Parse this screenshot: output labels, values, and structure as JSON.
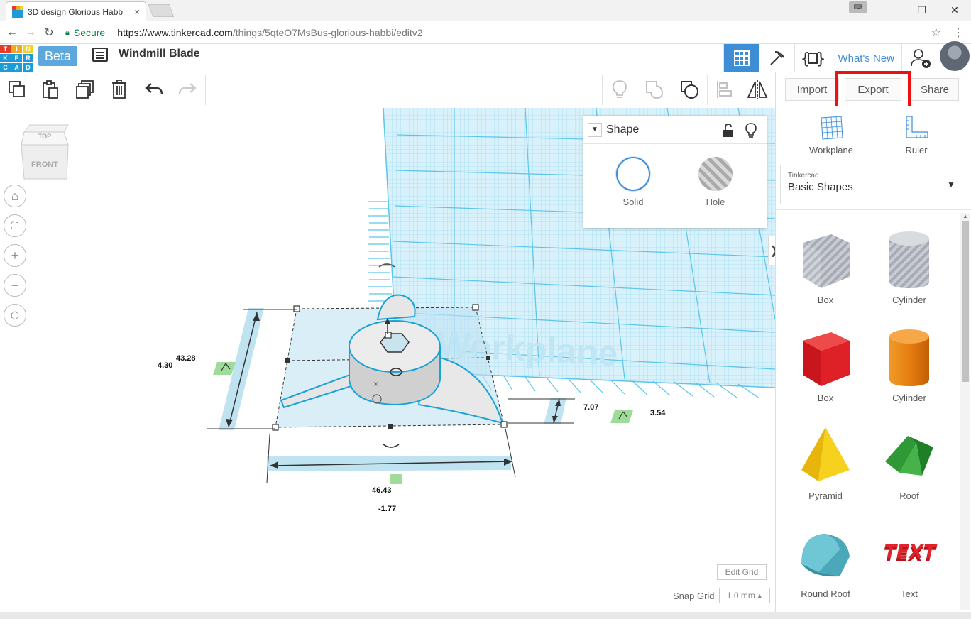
{
  "browser": {
    "tab_title": "3D design Glorious Habb",
    "tab_close": "×",
    "secure_label": "Secure",
    "url_host": "https://www.tinkercad.com",
    "url_path": "/things/5qteO7MsBus-glorious-habbi/editv2",
    "window_controls": [
      "—",
      "❐",
      "✕"
    ]
  },
  "app": {
    "logo_letters": [
      "T",
      "I",
      "N",
      "K",
      "E",
      "R",
      "C",
      "A",
      "D"
    ],
    "logo_colors": [
      "#e53a27",
      "#f0a91e",
      "#f7d024",
      "#1b9bd7",
      "#1b9bd7",
      "#1b9bd7",
      "#1b9bd7",
      "#1b9bd7",
      "#1b9bd7"
    ],
    "beta_label": "Beta",
    "design_title": "Windmill Blade",
    "whats_new": "What's New"
  },
  "toolbar": {
    "import_label": "Import",
    "export_label": "Export",
    "share_label": "Share"
  },
  "shape_panel": {
    "title": "Shape",
    "solid_label": "Solid",
    "hole_label": "Hole"
  },
  "dimensions": {
    "height": "43.28",
    "height_partial": "4.30",
    "width": "46.43",
    "depth": "7.07",
    "elevation": "3.54",
    "offset": "-1.77"
  },
  "viewcube": {
    "top_label": "TOP",
    "front_label": "FRONT"
  },
  "workplane_watermark": "Workplane",
  "grid": {
    "edit_label": "Edit Grid",
    "snap_label": "Snap Grid",
    "snap_value": "1.0 mm ▴"
  },
  "right_panel": {
    "workplane_label": "Workplane",
    "ruler_label": "Ruler",
    "library_provider": "Tinkercad",
    "library_name": "Basic Shapes",
    "shapes": [
      {
        "label": "Box",
        "icon": "box-hole-icon"
      },
      {
        "label": "Cylinder",
        "icon": "cylinder-hole-icon"
      },
      {
        "label": "Box",
        "icon": "box-solid-icon"
      },
      {
        "label": "Cylinder",
        "icon": "cylinder-solid-icon"
      },
      {
        "label": "Pyramid",
        "icon": "pyramid-icon"
      },
      {
        "label": "Roof",
        "icon": "roof-icon"
      },
      {
        "label": "Round Roof",
        "icon": "round-roof-icon"
      },
      {
        "label": "Text",
        "icon": "text-shape-icon"
      }
    ]
  },
  "colors": {
    "accent_blue": "#3e8dd7",
    "highlight_red": "#ee1111",
    "grid_blue": "#5bc5ea"
  }
}
